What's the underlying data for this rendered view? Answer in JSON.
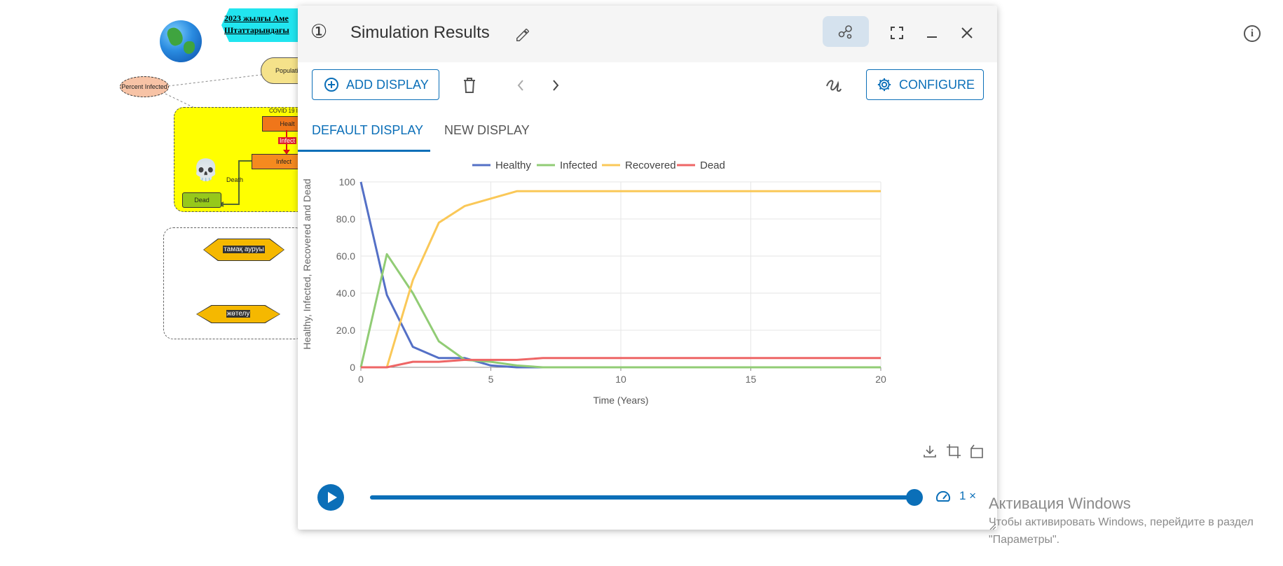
{
  "background": {
    "doc_title": "2023 жылғы Аме\nШтаттарындағы",
    "percent_infected": "Percent Infected",
    "population": "Populati",
    "covid_title": "COVID 19 I",
    "node_healthy": "Healt",
    "infect_label": "Infect",
    "node_infected": "Infect",
    "death_label": "Death",
    "node_dead": "Dead",
    "hex1": "тамақ ауруы",
    "hex2": "жөтелу",
    "windows_activation_title": "Активация Windows",
    "windows_activation_line1": "Чтобы активировать Windows, перейдите в раздел",
    "windows_activation_line2": "\"Параметры\"."
  },
  "dialog": {
    "number": "①",
    "title": "Simulation Results",
    "toolbar": {
      "add_display": "ADD DISPLAY",
      "configure": "CONFIGURE"
    },
    "tabs": [
      "DEFAULT DISPLAY",
      "NEW DISPLAY"
    ],
    "active_tab": 0,
    "playback": {
      "speed": "1 ×",
      "progress": 1.0
    }
  },
  "colors": {
    "accent": "#0b6fb8",
    "healthy": "#5470c6",
    "infected": "#91cc75",
    "recovered": "#fac858",
    "dead": "#ee6666"
  },
  "chart_data": {
    "type": "line",
    "title": "",
    "xlabel": "Time (Years)",
    "ylabel": "Healthy, Infected, Recovered and Dead",
    "xlim": [
      0,
      20
    ],
    "ylim": [
      0,
      100
    ],
    "x_ticks": [
      "0",
      "5",
      "10",
      "15",
      "20"
    ],
    "y_ticks": [
      "0",
      "20.0",
      "40.0",
      "60.0",
      "80.0",
      "100"
    ],
    "legend_position": "top-center",
    "grid": true,
    "x": [
      0,
      1,
      2,
      3,
      4,
      5,
      6,
      7,
      8,
      9,
      10,
      11,
      12,
      13,
      14,
      15,
      16,
      17,
      18,
      19,
      20
    ],
    "series": [
      {
        "name": "Healthy",
        "values": [
          100,
          39,
          11,
          5,
          5,
          1,
          0,
          0,
          0,
          0,
          0,
          0,
          0,
          0,
          0,
          0,
          0,
          0,
          0,
          0,
          0
        ]
      },
      {
        "name": "Infected",
        "values": [
          0,
          61,
          40,
          14,
          4,
          3,
          1,
          0,
          0,
          0,
          0,
          0,
          0,
          0,
          0,
          0,
          0,
          0,
          0,
          0,
          0
        ]
      },
      {
        "name": "Recovered",
        "values": [
          0,
          0,
          47,
          78,
          87,
          91,
          95,
          95,
          95,
          95,
          95,
          95,
          95,
          95,
          95,
          95,
          95,
          95,
          95,
          95,
          95
        ]
      },
      {
        "name": "Dead",
        "values": [
          0,
          0,
          3,
          3,
          4,
          4,
          4,
          5,
          5,
          5,
          5,
          5,
          5,
          5,
          5,
          5,
          5,
          5,
          5,
          5,
          5
        ]
      }
    ]
  }
}
